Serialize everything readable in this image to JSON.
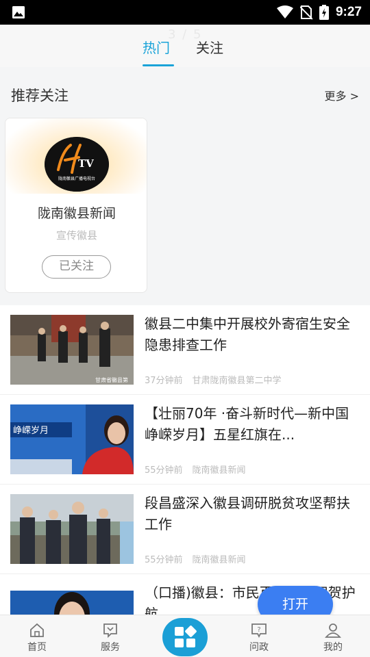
{
  "status_bar": {
    "time": "9:27",
    "icons": [
      "image-icon",
      "wifi-icon",
      "no-sim-icon",
      "battery-icon"
    ]
  },
  "top_nav": {
    "pager": "3 / 5",
    "tabs": [
      {
        "label": "热门",
        "active": true
      },
      {
        "label": "关注",
        "active": false
      }
    ]
  },
  "recommend": {
    "title": "推荐关注",
    "more": "更多 >",
    "card": {
      "logo_text": "HTV",
      "logo_subtitle": "陇南徽县广播电视台",
      "name": "陇南徽县新闻",
      "desc": "宣传徽县",
      "follow_label": "已关注"
    }
  },
  "news": [
    {
      "title": "徽县二中集中开展校外寄宿生安全隐患排查工作",
      "time": "37分钟前",
      "source": "甘肃陇南徽县第二中学",
      "thumb_caption": "甘肃省徽县第"
    },
    {
      "title": "【壮丽70年 ·奋斗新时代—新中国峥嵘岁月】五星红旗在...",
      "time": "55分钟前",
      "source": "陇南徽县新闻",
      "thumb_caption": "峥嵘岁月"
    },
    {
      "title": "段昌盛深入徽县调研脱贫攻坚帮扶工作",
      "time": "55分钟前",
      "source": "陇南徽县新闻",
      "thumb_caption": ""
    },
    {
      "title": "（口播)徽县：市民百姓游人祝贺护航",
      "time": "",
      "source": "",
      "thumb_caption": ""
    }
  ],
  "open_button": "打开",
  "tab_bar": [
    {
      "label": "首页",
      "icon": "home-icon"
    },
    {
      "label": "服务",
      "icon": "chat-icon"
    },
    {
      "label": "",
      "icon": "apps-grid-icon"
    },
    {
      "label": "问政",
      "icon": "question-icon"
    },
    {
      "label": "我的",
      "icon": "user-icon"
    }
  ],
  "colors": {
    "accent": "#1aa3d8",
    "open_button": "#3b7ef2",
    "center_button": "#1b9fd6"
  }
}
